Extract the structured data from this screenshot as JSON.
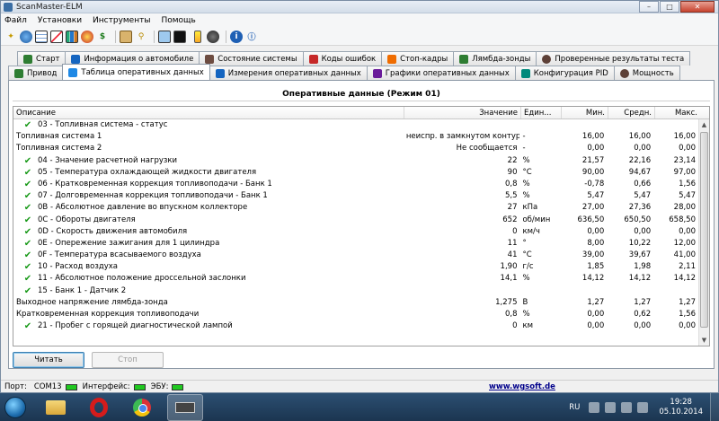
{
  "window": {
    "title": "ScanMaster-ELM"
  },
  "menu": [
    "Файл",
    "Установки",
    "Инструменты",
    "Помощь"
  ],
  "toolbar_icons": [
    "wizard-icon",
    "globe-icon",
    "table-icon",
    "chart-icon",
    "bar-icon",
    "gauge-icon",
    "dollar-icon",
    "clipboard-icon",
    "key-icon",
    "monitor-icon",
    "terminal-icon",
    "battery-icon",
    "record-icon",
    "info-icon",
    "about-icon"
  ],
  "tabs_row1": [
    {
      "label": "Старт",
      "icon_color": "#2e7d32"
    },
    {
      "label": "Информация о автомобиле",
      "icon_color": "#1565c0"
    },
    {
      "label": "Состояние системы",
      "icon_color": "#6d4c41"
    },
    {
      "label": "Коды ошибок",
      "icon_color": "#c62828"
    },
    {
      "label": "Стоп-кадры",
      "icon_color": "#ef6c00"
    },
    {
      "label": "Лямбда-зонды",
      "icon_color": "#2e7d32"
    },
    {
      "label": "Проверенные результаты теста",
      "icon_color": "#5d4037"
    }
  ],
  "tabs_row2": [
    {
      "label": "Привод",
      "icon_color": "#2e7d32"
    },
    {
      "label": "Таблица оперативных данных",
      "icon_color": "#1e88e5"
    },
    {
      "label": "Измерения оперативных данных",
      "icon_color": "#1565c0"
    },
    {
      "label": "Графики оперативных данных",
      "icon_color": "#6a1b9a"
    },
    {
      "label": "Конфигурация PID",
      "icon_color": "#00897b"
    },
    {
      "label": "Мощность",
      "icon_color": "#5d4037"
    }
  ],
  "panel": {
    "title": "Оперативные данные (Режим 01)",
    "columns": {
      "desc": "Описание",
      "val": "Значение",
      "unit": "Един...",
      "min": "Мин.",
      "avg": "Средн.",
      "max": "Макс."
    },
    "rows": [
      {
        "chk": true,
        "sub": false,
        "desc": "03 - Топливная система - статус",
        "val": "",
        "unit": "",
        "min": "",
        "avg": "",
        "max": ""
      },
      {
        "chk": false,
        "sub": true,
        "desc": "Топливная система 1",
        "val": "неиспр. в замкнутом контуре",
        "unit": "-",
        "min": "16,00",
        "avg": "16,00",
        "max": "16,00"
      },
      {
        "chk": false,
        "sub": true,
        "desc": "Топливная система 2",
        "val": "Не сообщается",
        "unit": "-",
        "min": "0,00",
        "avg": "0,00",
        "max": "0,00"
      },
      {
        "chk": true,
        "sub": false,
        "desc": "04 - Значение расчетной нагрузки",
        "val": "22",
        "unit": "%",
        "min": "21,57",
        "avg": "22,16",
        "max": "23,14"
      },
      {
        "chk": true,
        "sub": false,
        "desc": "05 - Температура охлаждающей жидкости двигателя",
        "val": "90",
        "unit": "°C",
        "min": "90,00",
        "avg": "94,67",
        "max": "97,00"
      },
      {
        "chk": true,
        "sub": false,
        "desc": "06 - Кратковременная коррекция топливоподачи - Банк 1",
        "val": "0,8",
        "unit": "%",
        "min": "-0,78",
        "avg": "0,66",
        "max": "1,56"
      },
      {
        "chk": true,
        "sub": false,
        "desc": "07 - Долговременная коррекция топливоподачи - Банк 1",
        "val": "5,5",
        "unit": "%",
        "min": "5,47",
        "avg": "5,47",
        "max": "5,47"
      },
      {
        "chk": true,
        "sub": false,
        "desc": "0B - Абсолютное давление во впускном коллекторе",
        "val": "27",
        "unit": "кПа",
        "min": "27,00",
        "avg": "27,36",
        "max": "28,00"
      },
      {
        "chk": true,
        "sub": false,
        "desc": "0C - Обороты двигателя",
        "val": "652",
        "unit": "об/мин",
        "min": "636,50",
        "avg": "650,50",
        "max": "658,50"
      },
      {
        "chk": true,
        "sub": false,
        "desc": "0D - Скорость движения автомобиля",
        "val": "0",
        "unit": "км/ч",
        "min": "0,00",
        "avg": "0,00",
        "max": "0,00"
      },
      {
        "chk": true,
        "sub": false,
        "desc": "0E - Опережение зажигания для 1 цилиндра",
        "val": "11",
        "unit": "°",
        "min": "8,00",
        "avg": "10,22",
        "max": "12,00"
      },
      {
        "chk": true,
        "sub": false,
        "desc": "0F - Температура всасываемого воздуха",
        "val": "41",
        "unit": "°C",
        "min": "39,00",
        "avg": "39,67",
        "max": "41,00"
      },
      {
        "chk": true,
        "sub": false,
        "desc": "10 - Расход воздуха",
        "val": "1,90",
        "unit": "г/с",
        "min": "1,85",
        "avg": "1,98",
        "max": "2,11"
      },
      {
        "chk": true,
        "sub": false,
        "desc": "11 - Абсолютное положение дроссельной заслонки",
        "val": "14,1",
        "unit": "%",
        "min": "14,12",
        "avg": "14,12",
        "max": "14,12"
      },
      {
        "chk": true,
        "sub": false,
        "desc": "15 - Банк 1 - Датчик 2",
        "val": "",
        "unit": "",
        "min": "",
        "avg": "",
        "max": ""
      },
      {
        "chk": false,
        "sub": true,
        "desc": "Выходное напряжение лямбда-зонда",
        "val": "1,275",
        "unit": "В",
        "min": "1,27",
        "avg": "1,27",
        "max": "1,27"
      },
      {
        "chk": false,
        "sub": true,
        "desc": "Кратковременная коррекция топливоподачи",
        "val": "0,8",
        "unit": "%",
        "min": "0,00",
        "avg": "0,62",
        "max": "1,56"
      },
      {
        "chk": true,
        "sub": false,
        "desc": "21 - Пробег с горящей диагностической лампой",
        "val": "0",
        "unit": "км",
        "min": "0,00",
        "avg": "0,00",
        "max": "0,00"
      }
    ]
  },
  "buttons": {
    "read": "Читать",
    "stop": "Стоп"
  },
  "statusbar": {
    "port_label": "Порт:",
    "port_value": "COM13",
    "interface_label": "Интерфейс:",
    "ecu_label": "ЭБУ:",
    "link": "www.wgsoft.de",
    "led_color": "#21c921"
  },
  "taskbar": {
    "lang": "RU",
    "time": "19:28",
    "date": "05.10.2014"
  }
}
